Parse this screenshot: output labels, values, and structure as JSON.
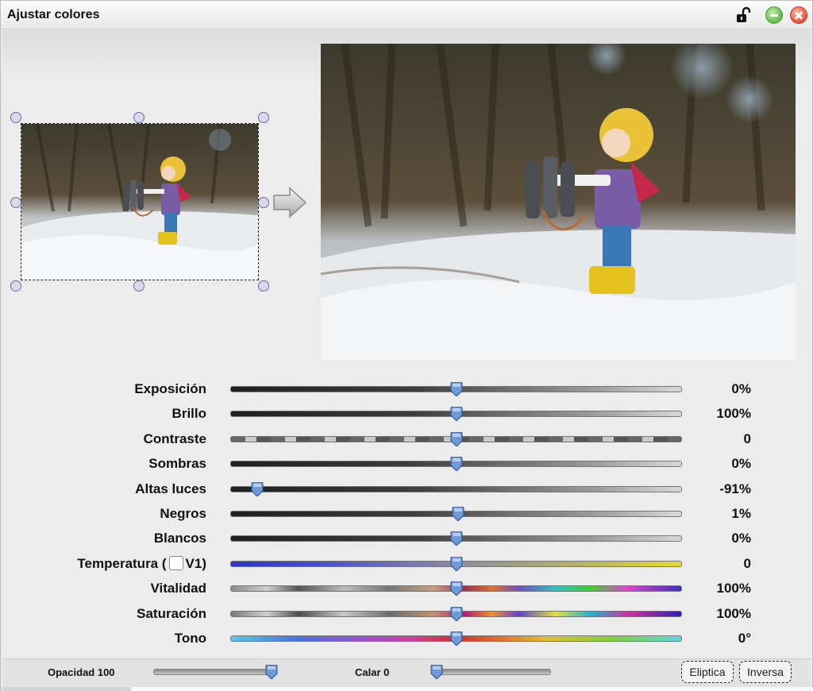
{
  "window": {
    "title": "Ajustar colores"
  },
  "sliders": [
    {
      "label": "Exposición",
      "value": "0%",
      "level": 0.5
    },
    {
      "label": "Brillo",
      "value": "100%",
      "level": 0.5
    },
    {
      "label": "Contraste",
      "value": "0",
      "level": 0.5
    },
    {
      "label": "Sombras",
      "value": "0%",
      "level": 0.5
    },
    {
      "label": "Altas luces",
      "value": "-91%",
      "level": 0.06
    },
    {
      "label": "Negros",
      "value": "1%",
      "level": 0.505
    },
    {
      "label": "Blancos",
      "value": "0%",
      "level": 0.5
    },
    {
      "label": "Temperatura (",
      "label_suffix": "V1)",
      "value": "0",
      "level": 0.5
    },
    {
      "label": "Vitalidad",
      "value": "100%",
      "level": 0.5
    },
    {
      "label": "Saturación",
      "value": "100%",
      "level": 0.5
    },
    {
      "label": "Tono",
      "value": "0°",
      "level": 0.5
    }
  ],
  "bottom": {
    "opacity_label": "Opacidad 100",
    "opacity_level": 1.0,
    "calar_label": "Calar 0",
    "calar_level": 0.0,
    "eliptica_label": "Eliptica",
    "inversa_label": "Inversa"
  },
  "icons": {
    "lock": "lock-open-icon",
    "minimize": "minimize-icon",
    "close": "close-icon",
    "arrow": "arrow-right-icon"
  },
  "colors": {
    "knob": "#6f9ad8",
    "minimize": "#5fbb44",
    "close": "#e8503a"
  }
}
